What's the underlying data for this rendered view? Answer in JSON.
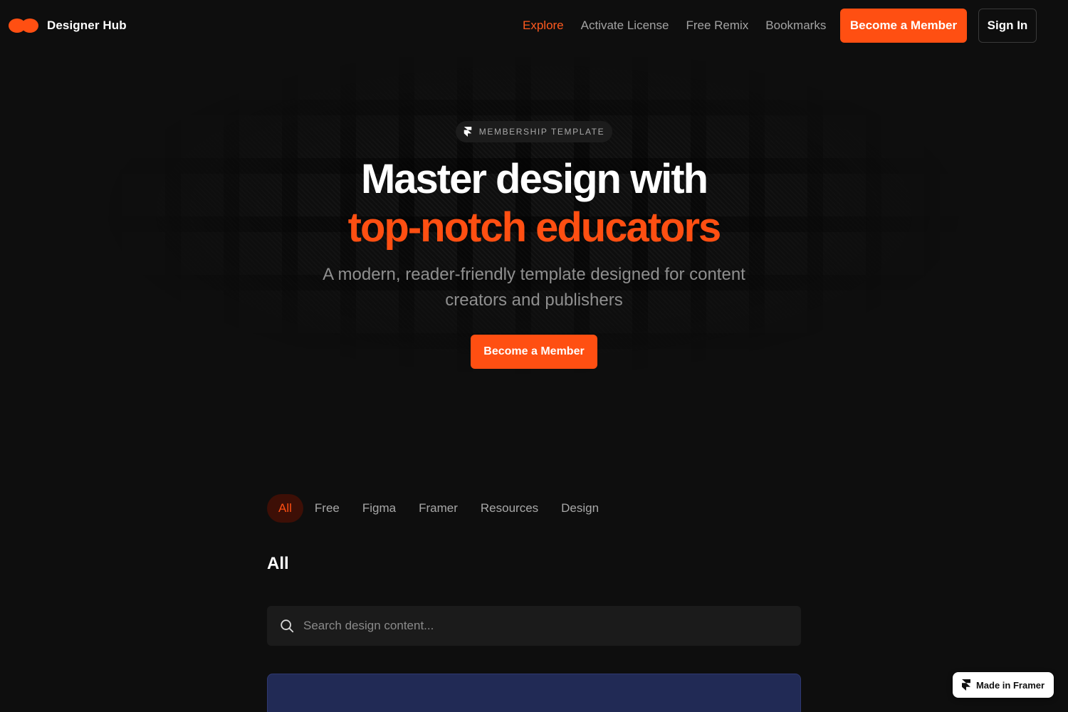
{
  "header": {
    "brand": "Designer Hub",
    "nav": [
      {
        "label": "Explore",
        "active": true
      },
      {
        "label": "Activate License",
        "active": false
      },
      {
        "label": "Free Remix",
        "active": false
      },
      {
        "label": "Bookmarks",
        "active": false
      }
    ],
    "cta_label": "Become a Member",
    "signin_label": "Sign In"
  },
  "hero": {
    "badge": "MEMBERSHIP TEMPLATE",
    "title_line1": "Master design with",
    "title_line2": "top-notch educators",
    "subtitle": "A modern, reader-friendly template designed for content creators and publishers",
    "cta_label": "Become a Member"
  },
  "categories": {
    "tabs": [
      {
        "label": "All",
        "active": true
      },
      {
        "label": "Free",
        "active": false
      },
      {
        "label": "Figma",
        "active": false
      },
      {
        "label": "Framer",
        "active": false
      },
      {
        "label": "Resources",
        "active": false
      },
      {
        "label": "Design",
        "active": false
      }
    ],
    "section_title": "All"
  },
  "search": {
    "placeholder": "Search design content...",
    "value": ""
  },
  "framer_badge": "Made in Framer",
  "colors": {
    "accent": "#ff4f12",
    "background": "#0e0e0e",
    "card": "#212a55"
  }
}
